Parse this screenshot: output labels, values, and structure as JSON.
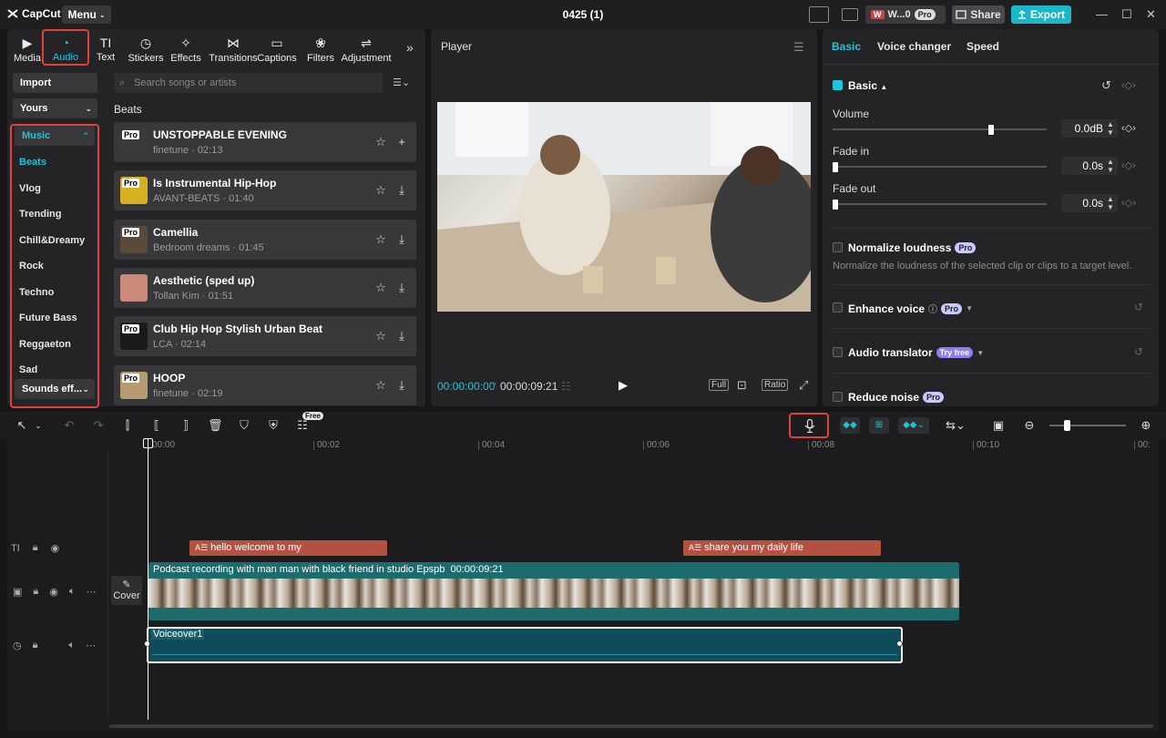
{
  "app": {
    "logo": "CapCut",
    "menu_label": "Menu",
    "project_title": "0425 (1)",
    "workspace_label": "W...0",
    "workspace_badge": "Pro",
    "share_label": "Share",
    "export_label": "Export"
  },
  "categories": [
    {
      "label": "Media",
      "icon": "media-icon"
    },
    {
      "label": "Audio",
      "icon": "audio-icon",
      "active": true
    },
    {
      "label": "Text",
      "icon": "text-icon"
    },
    {
      "label": "Stickers",
      "icon": "stickers-icon"
    },
    {
      "label": "Effects",
      "icon": "effects-icon"
    },
    {
      "label": "Transitions",
      "icon": "transitions-icon"
    },
    {
      "label": "Captions",
      "icon": "captions-icon"
    },
    {
      "label": "Filters",
      "icon": "filters-icon"
    },
    {
      "label": "Adjustment",
      "icon": "adjustment-icon"
    }
  ],
  "sidebar": {
    "import_label": "Import",
    "yours_label": "Yours",
    "music_label": "Music",
    "items": [
      "Beats",
      "Vlog",
      "Trending",
      "Chill&Dreamy",
      "Rock",
      "Techno",
      "Future Bass",
      "Reggaeton",
      "Sad"
    ],
    "sounds_label": "Sounds eff..."
  },
  "library": {
    "search_placeholder": "Search songs or artists",
    "section_title": "Beats",
    "songs": [
      {
        "title": "UNSTOPPABLE EVENING",
        "subtitle": "finetune · 02:13",
        "pro": "Pro",
        "thumb": "#3a3a3a",
        "action": "add"
      },
      {
        "title": "Is Instrumental Hip-Hop",
        "subtitle": "AVANT-BEATS · 01:40",
        "pro": "Pro",
        "thumb": "#d6b020",
        "action": "download"
      },
      {
        "title": "Camellia",
        "subtitle": "Bedroom dreams · 01:45",
        "pro": "Pro",
        "thumb": "#5a4a3a",
        "action": "download"
      },
      {
        "title": "Aesthetic (sped up)",
        "subtitle": "Tollan Kim · 01:51",
        "pro": "",
        "thumb": "#c98a7a",
        "action": "download"
      },
      {
        "title": "Club Hip Hop Stylish Urban Beat",
        "subtitle": "LCA · 02:14",
        "pro": "Pro",
        "thumb": "#1a1a1a",
        "action": "download"
      },
      {
        "title": "HOOP",
        "subtitle": "finetune · 02:19",
        "pro": "Pro",
        "thumb": "#b89a70",
        "action": "download"
      }
    ]
  },
  "player": {
    "title": "Player",
    "current_time": "00:00:00:00",
    "separator": "/",
    "total_time": "00:00:09:21",
    "full_label": "Full",
    "ratio_label": "Ratio"
  },
  "inspector": {
    "tabs": [
      "Basic",
      "Voice changer",
      "Speed"
    ],
    "basic_section": "Basic",
    "volume_label": "Volume",
    "volume_value": "0.0dB",
    "volume_level": 0.74,
    "fade_in_label": "Fade in",
    "fade_in_value": "0.0s",
    "fade_out_label": "Fade out",
    "fade_out_value": "0.0s",
    "normalize_label": "Normalize loudness",
    "normalize_desc": "Normalize the loudness of the selected clip or clips to a target level.",
    "enhance_label": "Enhance voice",
    "translator_label": "Audio translator",
    "try_free": "Try free",
    "reduce_noise_label": "Reduce noise",
    "pro_badge": "Pro"
  },
  "timeline": {
    "free_badge": "Free",
    "ruler": [
      "00:00",
      "00:02",
      "00:04",
      "00:06",
      "00:08",
      "00:10",
      "00:"
    ],
    "text_clips": [
      "hello welcome to my",
      "share you my daily life"
    ],
    "video_clip_label": "Podcast recording with man man with black friend in studio Epspb",
    "video_clip_duration": "00:00:09:21",
    "cover_label": "Cover",
    "voice_clip_label": "Voiceover1"
  }
}
